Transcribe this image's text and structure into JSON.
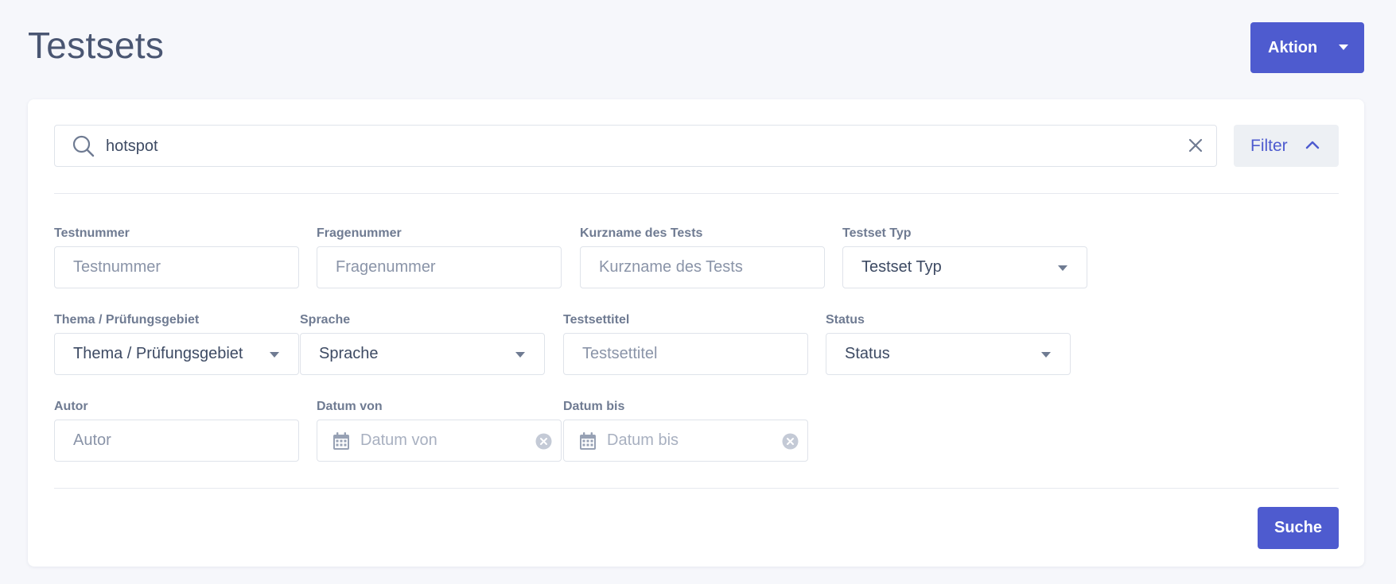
{
  "header": {
    "title": "Testsets",
    "action_label": "Aktion"
  },
  "search": {
    "value": "hotspot",
    "filter_label": "Filter"
  },
  "filters": {
    "testnummer": {
      "label": "Testnummer",
      "placeholder": "Testnummer"
    },
    "fragenummer": {
      "label": "Fragenummer",
      "placeholder": "Fragenummer"
    },
    "kurzname": {
      "label": "Kurzname des Tests",
      "placeholder": "Kurzname des Tests"
    },
    "testset_typ": {
      "label": "Testset Typ",
      "value": "Testset Typ"
    },
    "thema": {
      "label": "Thema / Prüfungsgebiet",
      "value": "Thema / Prüfungsgebiet"
    },
    "sprache": {
      "label": "Sprache",
      "value": "Sprache"
    },
    "testsettitel": {
      "label": "Testsettitel",
      "placeholder": "Testsettitel"
    },
    "status": {
      "label": "Status",
      "value": "Status"
    },
    "autor": {
      "label": "Autor",
      "placeholder": "Autor"
    },
    "datum_von": {
      "label": "Datum von",
      "placeholder": "Datum von"
    },
    "datum_bis": {
      "label": "Datum bis",
      "placeholder": "Datum bis"
    }
  },
  "submit_label": "Suche",
  "colors": {
    "primary": "#4e5bcf",
    "filter_bg": "#edf0f4",
    "page_bg": "#f6f7fb"
  }
}
